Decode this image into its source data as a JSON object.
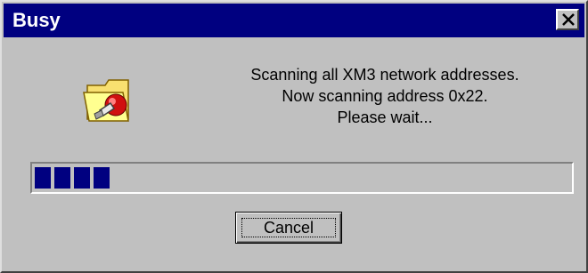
{
  "window": {
    "title": "Busy"
  },
  "titlebar": {
    "close_icon": "close-icon"
  },
  "message": {
    "line1": "Scanning all XM3 network addresses.",
    "line2": "Now scanning address 0x22.",
    "line3": "Please wait..."
  },
  "icon": {
    "name": "folder-network-icon"
  },
  "progress": {
    "filled_blocks": 4
  },
  "buttons": {
    "cancel": "Cancel"
  },
  "colors": {
    "titlebar": "#000080",
    "face": "#c0c0c0",
    "progress_fill": "#000080"
  }
}
